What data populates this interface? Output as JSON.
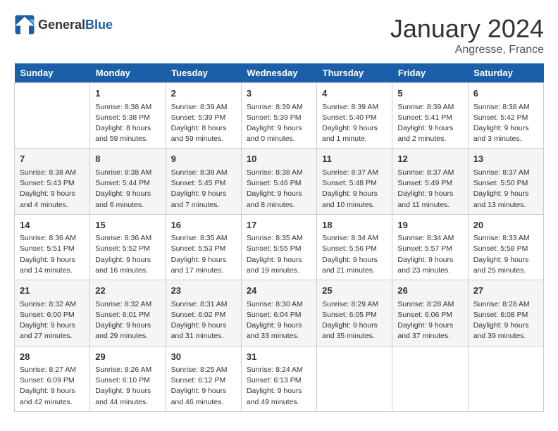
{
  "header": {
    "logo_general": "General",
    "logo_blue": "Blue",
    "title": "January 2024",
    "subtitle": "Angresse, France"
  },
  "days_of_week": [
    "Sunday",
    "Monday",
    "Tuesday",
    "Wednesday",
    "Thursday",
    "Friday",
    "Saturday"
  ],
  "weeks": [
    [
      {
        "day": "",
        "info": ""
      },
      {
        "day": "1",
        "info": "Sunrise: 8:38 AM\nSunset: 5:38 PM\nDaylight: 8 hours\nand 59 minutes."
      },
      {
        "day": "2",
        "info": "Sunrise: 8:39 AM\nSunset: 5:39 PM\nDaylight: 8 hours\nand 59 minutes."
      },
      {
        "day": "3",
        "info": "Sunrise: 8:39 AM\nSunset: 5:39 PM\nDaylight: 9 hours\nand 0 minutes."
      },
      {
        "day": "4",
        "info": "Sunrise: 8:39 AM\nSunset: 5:40 PM\nDaylight: 9 hours\nand 1 minute."
      },
      {
        "day": "5",
        "info": "Sunrise: 8:39 AM\nSunset: 5:41 PM\nDaylight: 9 hours\nand 2 minutes."
      },
      {
        "day": "6",
        "info": "Sunrise: 8:38 AM\nSunset: 5:42 PM\nDaylight: 9 hours\nand 3 minutes."
      }
    ],
    [
      {
        "day": "7",
        "info": "Sunrise: 8:38 AM\nSunset: 5:43 PM\nDaylight: 9 hours\nand 4 minutes."
      },
      {
        "day": "8",
        "info": "Sunrise: 8:38 AM\nSunset: 5:44 PM\nDaylight: 9 hours\nand 6 minutes."
      },
      {
        "day": "9",
        "info": "Sunrise: 8:38 AM\nSunset: 5:45 PM\nDaylight: 9 hours\nand 7 minutes."
      },
      {
        "day": "10",
        "info": "Sunrise: 8:38 AM\nSunset: 5:46 PM\nDaylight: 9 hours\nand 8 minutes."
      },
      {
        "day": "11",
        "info": "Sunrise: 8:37 AM\nSunset: 5:48 PM\nDaylight: 9 hours\nand 10 minutes."
      },
      {
        "day": "12",
        "info": "Sunrise: 8:37 AM\nSunset: 5:49 PM\nDaylight: 9 hours\nand 11 minutes."
      },
      {
        "day": "13",
        "info": "Sunrise: 8:37 AM\nSunset: 5:50 PM\nDaylight: 9 hours\nand 13 minutes."
      }
    ],
    [
      {
        "day": "14",
        "info": "Sunrise: 8:36 AM\nSunset: 5:51 PM\nDaylight: 9 hours\nand 14 minutes."
      },
      {
        "day": "15",
        "info": "Sunrise: 8:36 AM\nSunset: 5:52 PM\nDaylight: 9 hours\nand 16 minutes."
      },
      {
        "day": "16",
        "info": "Sunrise: 8:35 AM\nSunset: 5:53 PM\nDaylight: 9 hours\nand 17 minutes."
      },
      {
        "day": "17",
        "info": "Sunrise: 8:35 AM\nSunset: 5:55 PM\nDaylight: 9 hours\nand 19 minutes."
      },
      {
        "day": "18",
        "info": "Sunrise: 8:34 AM\nSunset: 5:56 PM\nDaylight: 9 hours\nand 21 minutes."
      },
      {
        "day": "19",
        "info": "Sunrise: 8:34 AM\nSunset: 5:57 PM\nDaylight: 9 hours\nand 23 minutes."
      },
      {
        "day": "20",
        "info": "Sunrise: 8:33 AM\nSunset: 5:58 PM\nDaylight: 9 hours\nand 25 minutes."
      }
    ],
    [
      {
        "day": "21",
        "info": "Sunrise: 8:32 AM\nSunset: 6:00 PM\nDaylight: 9 hours\nand 27 minutes."
      },
      {
        "day": "22",
        "info": "Sunrise: 8:32 AM\nSunset: 6:01 PM\nDaylight: 9 hours\nand 29 minutes."
      },
      {
        "day": "23",
        "info": "Sunrise: 8:31 AM\nSunset: 6:02 PM\nDaylight: 9 hours\nand 31 minutes."
      },
      {
        "day": "24",
        "info": "Sunrise: 8:30 AM\nSunset: 6:04 PM\nDaylight: 9 hours\nand 33 minutes."
      },
      {
        "day": "25",
        "info": "Sunrise: 8:29 AM\nSunset: 6:05 PM\nDaylight: 9 hours\nand 35 minutes."
      },
      {
        "day": "26",
        "info": "Sunrise: 8:28 AM\nSunset: 6:06 PM\nDaylight: 9 hours\nand 37 minutes."
      },
      {
        "day": "27",
        "info": "Sunrise: 8:28 AM\nSunset: 6:08 PM\nDaylight: 9 hours\nand 39 minutes."
      }
    ],
    [
      {
        "day": "28",
        "info": "Sunrise: 8:27 AM\nSunset: 6:09 PM\nDaylight: 9 hours\nand 42 minutes."
      },
      {
        "day": "29",
        "info": "Sunrise: 8:26 AM\nSunset: 6:10 PM\nDaylight: 9 hours\nand 44 minutes."
      },
      {
        "day": "30",
        "info": "Sunrise: 8:25 AM\nSunset: 6:12 PM\nDaylight: 9 hours\nand 46 minutes."
      },
      {
        "day": "31",
        "info": "Sunrise: 8:24 AM\nSunset: 6:13 PM\nDaylight: 9 hours\nand 49 minutes."
      },
      {
        "day": "",
        "info": ""
      },
      {
        "day": "",
        "info": ""
      },
      {
        "day": "",
        "info": ""
      }
    ]
  ]
}
